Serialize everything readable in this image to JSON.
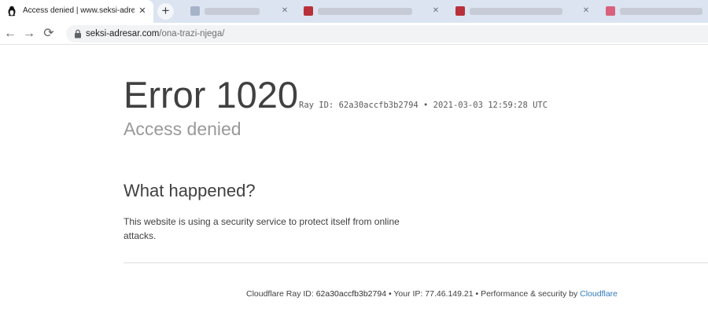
{
  "browser": {
    "active_tab": {
      "title": "Access denied | www.seksi-adres",
      "close_glyph": "✕",
      "favicon": "penguin-icon"
    },
    "new_tab_glyph": "+",
    "background_tabs": [
      {
        "favicon_color": "#a7b3c8"
      },
      {
        "favicon_color": "#b8313a"
      },
      {
        "favicon_color": "#b8313a"
      },
      {
        "favicon_color": "#d9617b"
      }
    ],
    "toolbar": {
      "back_glyph": "←",
      "forward_glyph": "→",
      "reload_glyph": "⟳"
    },
    "address_bar": {
      "host": "seksi-adresar.com",
      "path": "/ona-trazi-njega/"
    }
  },
  "page": {
    "error_code": "Error 1020",
    "ray_id_line": "Ray ID: 62a30accfb3b2794 • 2021-03-03 12:59:28 UTC",
    "subtitle": "Access denied",
    "section_title": "What happened?",
    "explanation": "This website is using a security service to protect itself from online attacks.",
    "footer": {
      "ray_label": "Cloudflare Ray ID: ",
      "ray_id": "62a30accfb3b2794",
      "ip_label": " • Your IP: ",
      "ip": "77.46.149.21",
      "perf_label": " • Performance & security by ",
      "cloudflare_link": "Cloudflare"
    }
  },
  "colors": {
    "tabstrip": "#dbe4f0",
    "link": "#2f7bbf",
    "subtitle_gray": "#999999"
  }
}
